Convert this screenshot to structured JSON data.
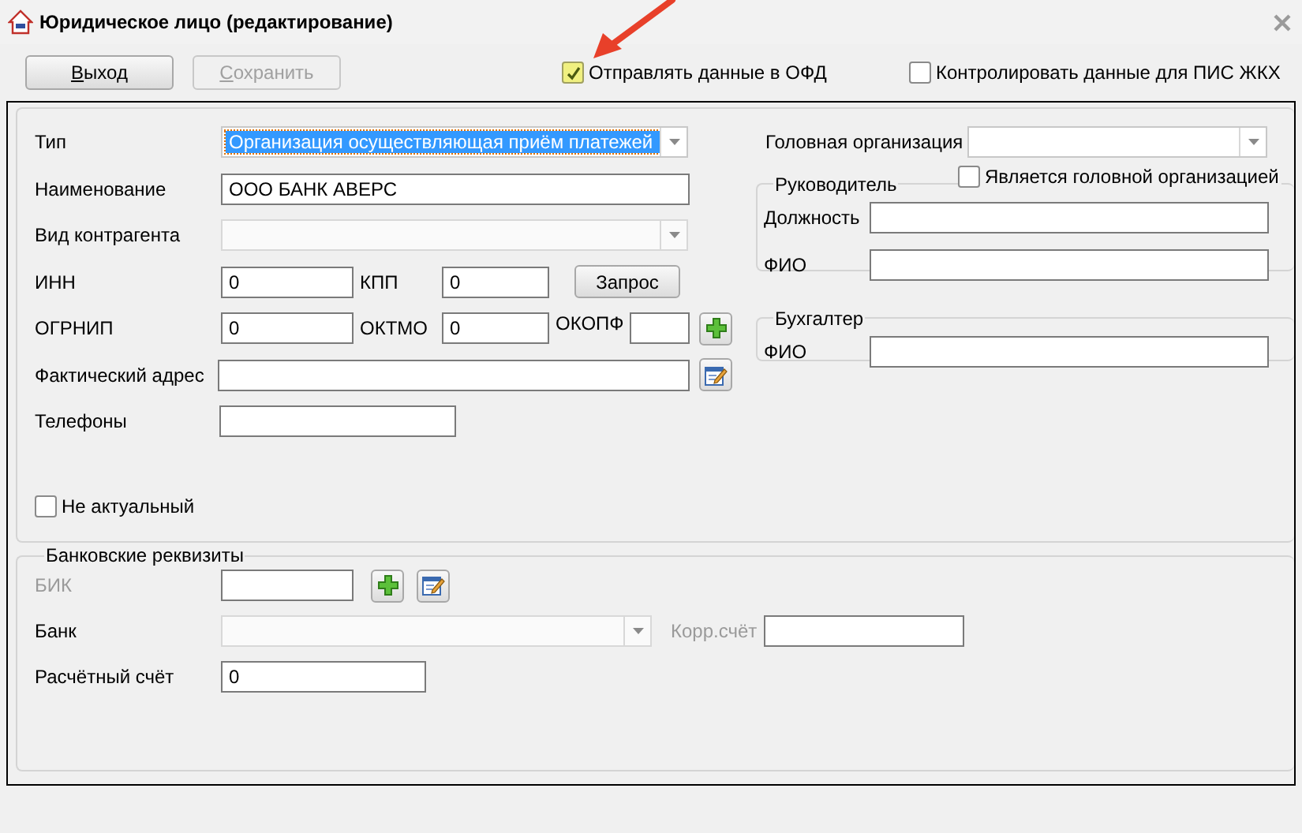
{
  "window": {
    "title": "Юридическое лицо (редактирование)"
  },
  "toolbar": {
    "buttons": [
      {
        "label": "Выход",
        "disabled": false
      },
      {
        "label": "Сохранить",
        "disabled": true
      }
    ],
    "options": [
      {
        "label": "Отправлять данные в ОФД",
        "checked": true
      },
      {
        "label": "Контролировать данные для ПИС ЖКХ",
        "checked": false
      }
    ]
  },
  "organization": {
    "type": {
      "label": "Тип",
      "value": "Организация осуществляющая приём платежей",
      "highlighted": true
    },
    "name": {
      "label": "Наименование",
      "value": "ООО БАНК АВЕРС"
    },
    "counterparty_kind": {
      "label": "Вид контрагента",
      "disabled": true
    },
    "inn": {
      "label": "ИНН",
      "value": "0"
    },
    "kpp": {
      "label": "КПП",
      "value": "0"
    },
    "request_button": "Запрос",
    "ogrnip": {
      "label": "ОГРНИП",
      "value": "0"
    },
    "oktmo": {
      "label": "ОКТМО",
      "value": "0"
    },
    "okopf": {
      "label": "ОКОПФ"
    },
    "address": {
      "label": "Фактический адрес"
    },
    "phones": {
      "label": "Телефоны"
    },
    "not_actual": {
      "label": "Не актуальный",
      "checked": false
    }
  },
  "head_organization": {
    "label": "Головная организация",
    "is_head": {
      "label": "Является головной организацией",
      "checked": false
    }
  },
  "director": {
    "title": "Руководитель",
    "position": {
      "label": "Должность"
    },
    "full_name": {
      "label": "ФИО"
    }
  },
  "accountant": {
    "title": "Бухгалтер",
    "full_name": {
      "label": "ФИО"
    }
  },
  "bank_details": {
    "title": "Банковские реквизиты",
    "bik": {
      "label": "БИК",
      "disabled": true
    },
    "bank": {
      "label": "Банк",
      "disabled": true
    },
    "corr_account": {
      "label": "Корр.счёт",
      "disabled": true
    },
    "account": {
      "label": "Расчётный счёт",
      "value": "0"
    }
  }
}
